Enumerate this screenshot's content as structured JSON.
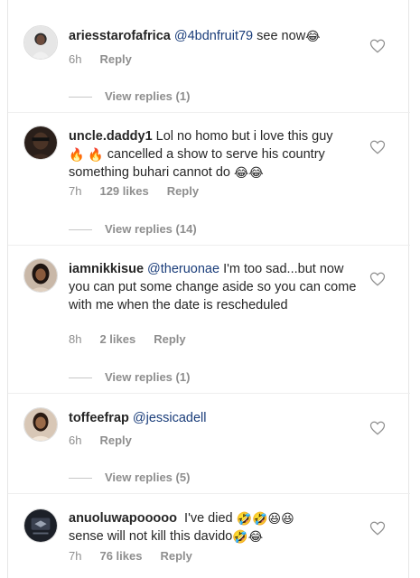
{
  "comments": [
    {
      "username": "ariesstarofafrica",
      "mention": "@4bdnfruit79",
      "text": " see now",
      "emojis": "😂",
      "time": "6h",
      "likes": "",
      "reply": "Reply",
      "view_replies": "View replies (1)",
      "avatar_color": "#d9d9d9"
    },
    {
      "username": "uncle.daddy1",
      "text_a": "Lol no homo but i love this guy",
      "fire": "🔥 🔥",
      "text_b": " cancelled a show to serve his country something buhari cannot do ",
      "emojis": "😂😂",
      "time": "7h",
      "likes": "129 likes",
      "reply": "Reply",
      "view_replies": "View replies (14)",
      "avatar_color": "#3a2a20"
    },
    {
      "username": "iamnikkisue",
      "mention": "@theruonae",
      "text": " I'm too sad...but now you can put some change aside so you can come with me when the date is rescheduled",
      "time": "8h",
      "likes": "2 likes",
      "reply": "Reply",
      "view_replies": "View replies (1)",
      "avatar_color": "#5a3b28"
    },
    {
      "username": "toffeefrap",
      "mention": "@jessicadell",
      "text": "",
      "time": "6h",
      "likes": "",
      "reply": "Reply",
      "view_replies": "View replies (5)",
      "avatar_color": "#6b4a36"
    },
    {
      "username": "anuoluwapooooo",
      "text_a": " I've died ",
      "emojis_a": "🤣🤣😆😆",
      "text_b": "sense will not kill this davido",
      "emojis_b": "🤣😂",
      "time": "7h",
      "likes": "76 likes",
      "reply": "Reply",
      "avatar_color": "#2b2f38"
    }
  ],
  "colors": {
    "mention": "#1a3d7a",
    "meta": "#8e8e8e",
    "text": "#262626"
  },
  "icons": {
    "like": "heart-outline-icon"
  }
}
